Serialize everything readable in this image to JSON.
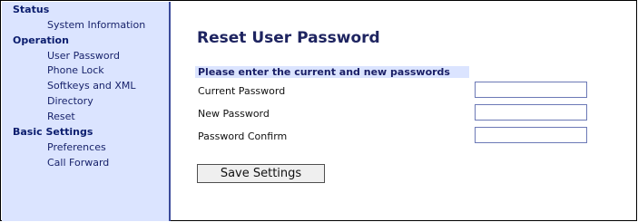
{
  "sidebar": {
    "status_heading": "Status",
    "system_information": "System Information",
    "operation_heading": "Operation",
    "user_password": "User Password",
    "phone_lock": "Phone Lock",
    "softkeys_xml": "Softkeys and XML",
    "directory": "Directory",
    "reset": "Reset",
    "basic_settings_heading": "Basic Settings",
    "preferences": "Preferences",
    "call_forward": "Call Forward"
  },
  "main": {
    "title": "Reset User Password",
    "instructions": "Please enter the current and new passwords",
    "fields": {
      "current_label": "Current Password",
      "current_value": "",
      "new_label": "New Password",
      "new_value": "",
      "confirm_label": "Password Confirm",
      "confirm_value": ""
    },
    "save_label": "Save Settings"
  }
}
